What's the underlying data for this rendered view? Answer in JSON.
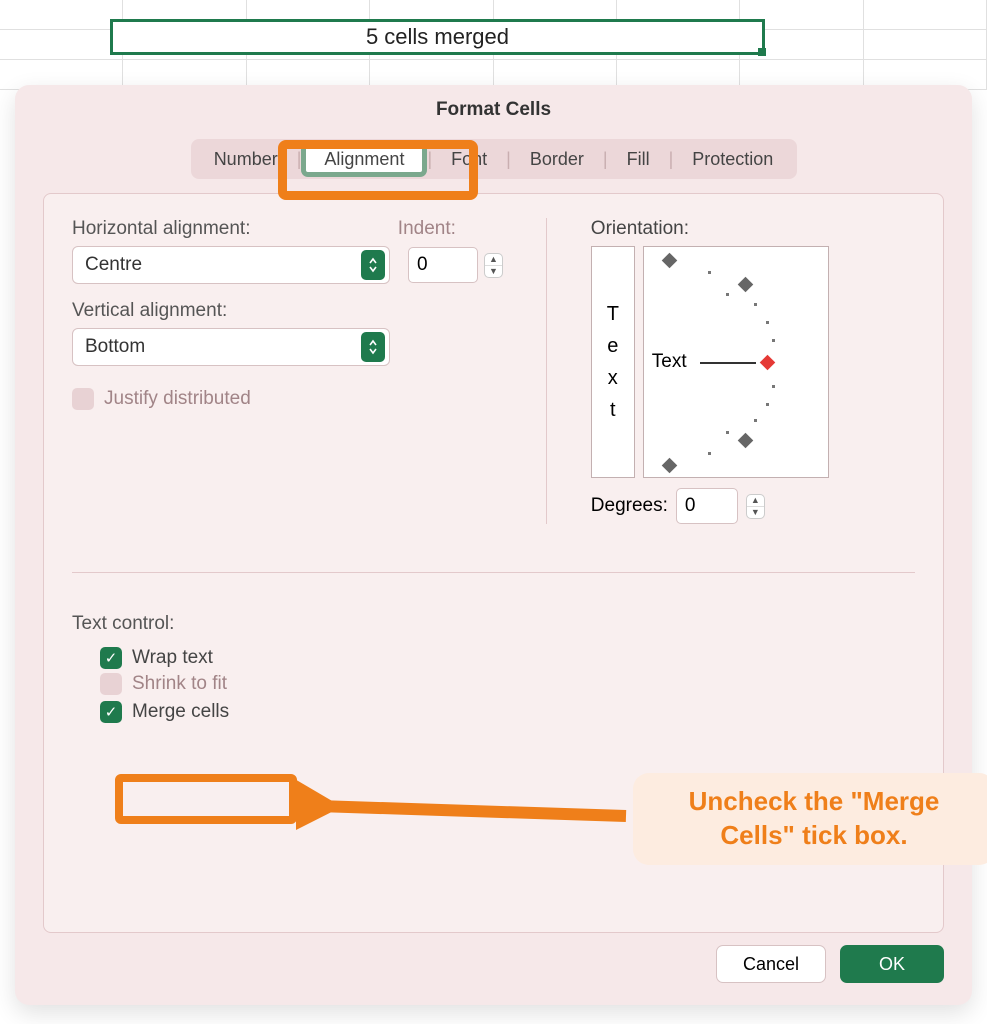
{
  "spreadsheet": {
    "merged_cell_text": "5 cells merged"
  },
  "dialog": {
    "title": "Format Cells",
    "tabs": [
      "Number",
      "Alignment",
      "Font",
      "Border",
      "Fill",
      "Protection"
    ],
    "active_tab": "Alignment",
    "alignment": {
      "horizontal_label": "Horizontal alignment:",
      "horizontal_value": "Centre",
      "indent_label": "Indent:",
      "indent_value": "0",
      "vertical_label": "Vertical alignment:",
      "vertical_value": "Bottom",
      "justify_distributed_label": "Justify distributed",
      "justify_distributed_checked": false
    },
    "orientation": {
      "label": "Orientation:",
      "vertical_text": "Text",
      "horizontal_text": "Text",
      "degrees_label": "Degrees:",
      "degrees_value": "0"
    },
    "text_control": {
      "label": "Text control:",
      "wrap_label": "Wrap text",
      "wrap_checked": true,
      "shrink_label": "Shrink to fit",
      "shrink_enabled": false,
      "merge_label": "Merge cells",
      "merge_checked": true
    },
    "buttons": {
      "cancel": "Cancel",
      "ok": "OK"
    }
  },
  "annotation": {
    "text": "Uncheck the \"Merge Cells\" tick box."
  }
}
